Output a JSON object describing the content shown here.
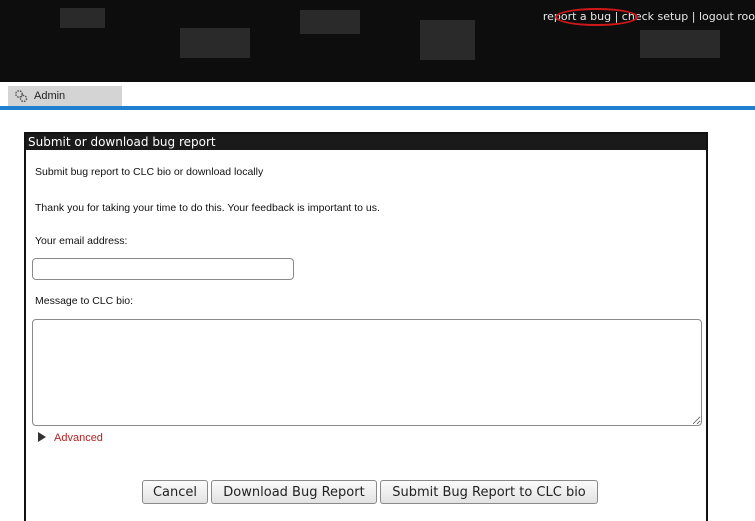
{
  "header": {
    "links": [
      {
        "label": "report a bug"
      },
      {
        "label": "check setup"
      },
      {
        "label": "logout roo"
      }
    ],
    "separator": " | "
  },
  "tabs": [
    {
      "label": "Admin",
      "icon": "admin-gear-icon"
    }
  ],
  "panel": {
    "title": "Submit or download bug report",
    "intro": "Submit bug report to CLC bio or download locally",
    "thanks": "Thank you for taking your time to do this. Your feedback is important to us.",
    "email_label": "Your email address:",
    "email_value": "",
    "message_label": "Message to CLC bio:",
    "message_value": "",
    "advanced_label": "Advanced"
  },
  "buttons": {
    "cancel": "Cancel",
    "download": "Download Bug Report",
    "submit": "Submit Bug Report to CLC bio"
  },
  "colors": {
    "accent_line": "#1f7fd0",
    "advanced_link": "#b22222",
    "annotation": "#d01818"
  }
}
